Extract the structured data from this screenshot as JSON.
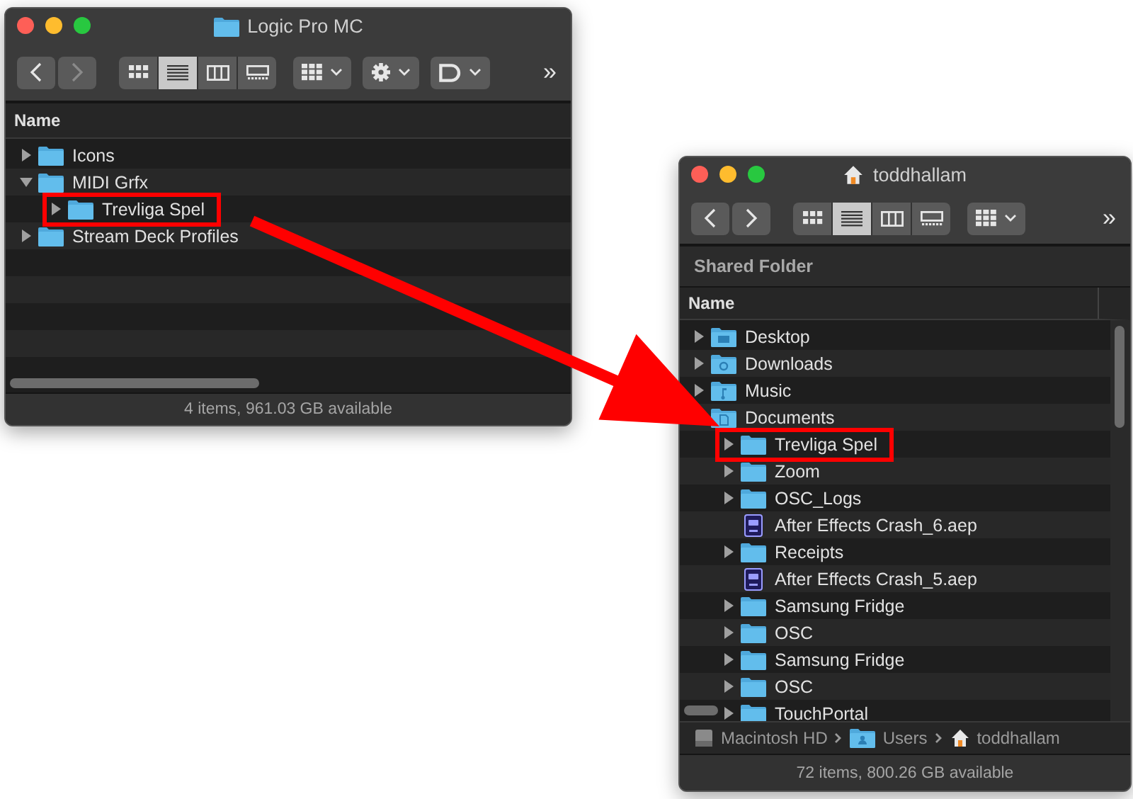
{
  "windows": [
    {
      "title": "Logic Pro MC",
      "kind": "folder",
      "toolbar": {
        "nav": [
          {
            "kind": "back",
            "disabled": false
          },
          {
            "kind": "forward",
            "disabled": true
          }
        ],
        "views": [
          {
            "kind": "icons",
            "selected": false
          },
          {
            "kind": "list",
            "selected": true
          },
          {
            "kind": "columns",
            "selected": false
          },
          {
            "kind": "gallery",
            "selected": false
          }
        ],
        "menus": [
          {
            "kind": "group"
          },
          {
            "kind": "action"
          },
          {
            "kind": "share"
          }
        ],
        "overflow": "»"
      },
      "columns": [
        "Name"
      ],
      "rows": [
        {
          "name": "Icons",
          "kind": "folder",
          "expanded": false,
          "highlighted": false
        },
        {
          "name": "MIDI Grfx",
          "kind": "folder",
          "expanded": true,
          "highlighted": false,
          "children": [
            {
              "name": "Trevliga Spel",
              "kind": "folder",
              "expanded": false,
              "highlighted": true
            }
          ]
        },
        {
          "name": "Stream Deck Profiles",
          "kind": "folder",
          "expanded": false,
          "highlighted": false
        }
      ],
      "status": "4 items, 961.03 GB available"
    },
    {
      "title": "toddhallam",
      "kind": "home",
      "toolbar": {
        "nav": [
          {
            "kind": "back",
            "disabled": false
          },
          {
            "kind": "forward",
            "disabled": false
          }
        ],
        "views": [
          {
            "kind": "icons",
            "selected": false
          },
          {
            "kind": "list",
            "selected": true
          },
          {
            "kind": "columns",
            "selected": false
          },
          {
            "kind": "gallery",
            "selected": false
          }
        ],
        "menus": [
          {
            "kind": "group"
          }
        ],
        "overflow": "»"
      },
      "location": "Shared Folder",
      "columns": [
        "Name"
      ],
      "rows": [
        {
          "name": "Desktop",
          "kind": "desktop",
          "expanded": false,
          "highlighted": false
        },
        {
          "name": "Downloads",
          "kind": "downloads",
          "expanded": false,
          "highlighted": false
        },
        {
          "name": "Music",
          "kind": "music",
          "expanded": false,
          "highlighted": false
        },
        {
          "name": "Documents",
          "kind": "documents",
          "expanded": true,
          "highlighted": false,
          "children": [
            {
              "name": "Trevliga Spel",
              "kind": "folder",
              "expanded": false,
              "highlighted": true
            },
            {
              "name": "Zoom",
              "kind": "folder",
              "expanded": false,
              "highlighted": false
            },
            {
              "name": "OSC_Logs",
              "kind": "folder",
              "expanded": false,
              "highlighted": false
            },
            {
              "name": "After Effects Crash_6.aep",
              "kind": "aep",
              "highlighted": false
            },
            {
              "name": "Receipts",
              "kind": "folder",
              "expanded": false,
              "highlighted": false
            },
            {
              "name": "After Effects Crash_5.aep",
              "kind": "aep",
              "highlighted": false
            },
            {
              "name": "Samsung Fridge",
              "kind": "folder",
              "expanded": false,
              "highlighted": false
            },
            {
              "name": "OSC",
              "kind": "folder",
              "expanded": false,
              "highlighted": false
            },
            {
              "name": "Samsung Fridge",
              "kind": "folder",
              "expanded": false,
              "highlighted": false
            },
            {
              "name": "OSC",
              "kind": "folder",
              "expanded": false,
              "highlighted": false
            },
            {
              "name": "TouchPortal",
              "kind": "folder",
              "expanded": false,
              "highlighted": false
            }
          ]
        }
      ],
      "path": [
        {
          "kind": "disk",
          "label": "Macintosh HD"
        },
        {
          "kind": "users",
          "label": "Users"
        },
        {
          "kind": "home",
          "label": "toddhallam"
        }
      ],
      "status": "72 items, 800.26 GB available"
    }
  ]
}
